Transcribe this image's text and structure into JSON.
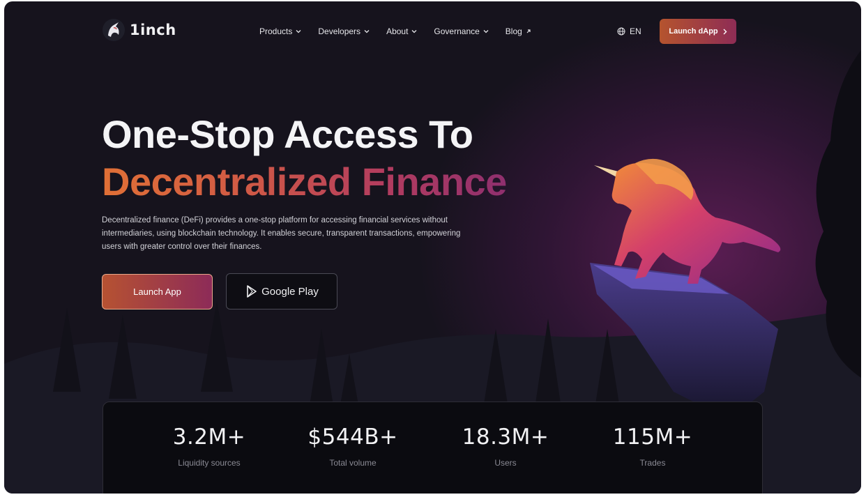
{
  "header": {
    "logo_text": "1inch",
    "nav": [
      {
        "label": "Products",
        "icon": "chevron-down-icon"
      },
      {
        "label": "Developers",
        "icon": "chevron-down-icon"
      },
      {
        "label": "About",
        "icon": "chevron-down-icon"
      },
      {
        "label": "Governance",
        "icon": "chevron-down-icon"
      },
      {
        "label": "Blog",
        "icon": "external-arrow-icon"
      }
    ],
    "language": "EN",
    "cta_label": "Launch dApp"
  },
  "hero": {
    "title_line1": "One-Stop Access To",
    "title_line2": "Decentralized Finance",
    "description": "Decentralized finance (DeFi) provides a one-stop platform for accessing financial services without intermediaries, using blockchain technology. It enables secure, transparent transactions, empowering users with greater control over their finances.",
    "primary_button": "Launch App",
    "secondary_button": "Google Play"
  },
  "stats": [
    {
      "value": "3.2M+",
      "label": "Liquidity sources"
    },
    {
      "value": "$544B+",
      "label": "Total volume"
    },
    {
      "value": "18.3M+",
      "label": "Users"
    },
    {
      "value": "115M+",
      "label": "Trades"
    }
  ],
  "colors": {
    "background": "#14131a",
    "accent_start": "#e07036",
    "accent_end": "#8f2f6e",
    "text_primary": "#f4f4f6",
    "text_muted": "#8a8a94"
  }
}
